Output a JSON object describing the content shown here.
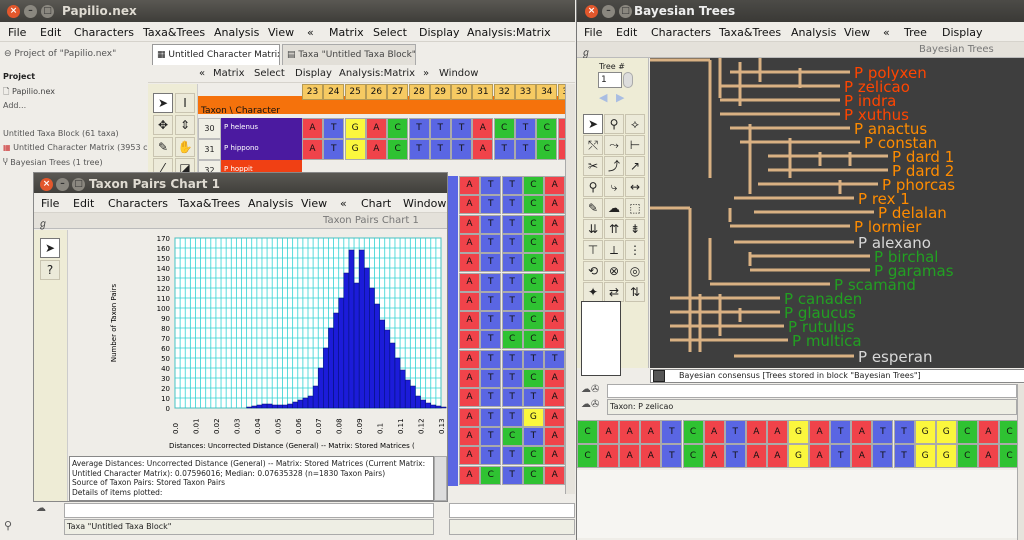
{
  "main": {
    "title": "Papilio.nex",
    "menu": [
      "File",
      "Edit",
      "Characters",
      "Taxa&Trees",
      "Analysis",
      "View",
      "«",
      "Matrix",
      "Select",
      "Display",
      "Analysis:Matrix"
    ],
    "project": {
      "header": "Project of \"Papilio.nex\"",
      "label": "Project",
      "file": "Papilio.nex",
      "add": "Add...",
      "items": [
        "Untitled Taxa Block (61 taxa)",
        "Untitled Character Matrix (3953 cha",
        "Bayesian Trees (1 tree)"
      ]
    },
    "tabs": [
      "Untitled Character Matrix",
      "Taxa \"Untitled Taxa Block\""
    ],
    "matrix_menu": [
      "«",
      "Matrix",
      "Select",
      "Display",
      "Analysis:Matrix",
      "»",
      "Window"
    ],
    "corner": "Taxon \\ Character",
    "col_headers": [
      "23",
      "24",
      "25",
      "26",
      "27",
      "28",
      "29",
      "30",
      "31",
      "32",
      "33",
      "34",
      "35",
      "36"
    ],
    "rows": [
      {
        "num": "30",
        "taxon": "P helenus",
        "bases": [
          "A",
          "T",
          "G",
          "A",
          "C",
          "T",
          "T",
          "T",
          "A",
          "C",
          "T",
          "C",
          "A",
          "A"
        ]
      },
      {
        "num": "31",
        "taxon": "P hippono",
        "bases": [
          "A",
          "T",
          "G",
          "A",
          "C",
          "T",
          "T",
          "T",
          "A",
          "T",
          "T",
          "C",
          "A",
          "A"
        ]
      },
      {
        "num": "32",
        "taxon": "P hoppit"
      }
    ],
    "lower_cols": [
      "A",
      "T",
      "C",
      "T",
      "A"
    ],
    "lower_grid": [
      [
        "A",
        "T",
        "T",
        "C",
        "A"
      ],
      [
        "A",
        "T",
        "T",
        "C",
        "A"
      ],
      [
        "A",
        "T",
        "T",
        "C",
        "A"
      ],
      [
        "A",
        "T",
        "T",
        "C",
        "A"
      ],
      [
        "A",
        "T",
        "T",
        "C",
        "A"
      ],
      [
        "A",
        "T",
        "T",
        "C",
        "A"
      ],
      [
        "A",
        "T",
        "T",
        "C",
        "A"
      ],
      [
        "A",
        "T",
        "T",
        "C",
        "A"
      ],
      [
        "A",
        "T",
        "C",
        "C",
        "A"
      ],
      [
        "A",
        "T",
        "T",
        "T",
        "T"
      ],
      [
        "A",
        "T",
        "T",
        "C",
        "A"
      ],
      [
        "A",
        "T",
        "T",
        "T",
        "A"
      ],
      [
        "A",
        "T",
        "T",
        "G",
        "A"
      ],
      [
        "A",
        "T",
        "C",
        "T",
        "A"
      ],
      [
        "A",
        "T",
        "T",
        "C",
        "A"
      ],
      [
        "A",
        "C",
        "T",
        "C",
        "A"
      ]
    ],
    "status": "Taxa \"Untitled Taxa Block\""
  },
  "chart_win": {
    "title": "Taxon Pairs Chart 1",
    "menu": [
      "File",
      "Edit",
      "Characters",
      "Taxa&Trees",
      "Analysis",
      "View",
      "«",
      "Chart",
      "Window"
    ],
    "subtitle": "Taxon Pairs Chart 1",
    "text": [
      "Average Distances: Uncorrected Distance (General) -- Matrix: Stored Matrices (Current Matrix:",
      "Untitled Character Matrix): 0.07596016; Median: 0.07635328  (n=1830 Taxon Pairs)",
      "Source of  Taxon Pairs: Stored Taxon Pairs",
      "Details of items plotted:"
    ]
  },
  "chart_data": {
    "type": "bar",
    "xlabel": "Distances: Uncorrected Distance (General) -- Matrix: Stored Matrices (",
    "ylabel": "Number of Taxon Pairs",
    "ylim": [
      0,
      170
    ],
    "xlim": [
      0,
      0.13
    ],
    "yticks": [
      "0",
      "10",
      "20",
      "30",
      "40",
      "50",
      "60",
      "70",
      "80",
      "90",
      "100",
      "110",
      "120",
      "130",
      "140",
      "150",
      "160",
      "170"
    ],
    "xticks": [
      "0.0",
      "0.01",
      "0.02",
      "0.03",
      "0.04",
      "0.05",
      "0.06",
      "0.07",
      "0.08",
      "0.09",
      "0.1",
      "0.11",
      "0.12",
      "0.13"
    ],
    "bin_start": 0.0,
    "bin_width": 0.0025,
    "values": [
      0,
      0,
      0,
      0,
      0,
      0,
      0,
      0,
      0,
      0,
      0,
      0,
      0,
      0,
      1,
      2,
      3,
      4,
      4,
      3,
      3,
      3,
      4,
      6,
      8,
      10,
      12,
      22,
      40,
      60,
      80,
      95,
      110,
      135,
      158,
      125,
      158,
      140,
      120,
      104,
      88,
      78,
      65,
      50,
      38,
      28,
      22,
      12,
      8,
      5,
      3,
      2,
      1,
      0
    ],
    "bar_color": "#1c1cd9",
    "grid_color": "#33d3d3"
  },
  "trees": {
    "title": "Bayesian Trees",
    "menu": [
      "File",
      "Edit",
      "Characters",
      "Taxa&Trees",
      "Analysis",
      "View",
      "«",
      "Tree",
      "Display"
    ],
    "subtitle": "Bayesian Trees",
    "tree_label": "Tree #",
    "tree_num": "1",
    "leaves": [
      {
        "name": "P polyxen",
        "color": "#ff4500"
      },
      {
        "name": "P zelicao",
        "color": "#ff4500"
      },
      {
        "name": "P indra",
        "color": "#ff4500"
      },
      {
        "name": "P xuthus",
        "color": "#ff4500"
      },
      {
        "name": "P anactus",
        "color": "#ff8c00"
      },
      {
        "name": "P constan",
        "color": "#ff8c00"
      },
      {
        "name": "P dard 1",
        "color": "#ff8c00"
      },
      {
        "name": "P dard 2",
        "color": "#ff8c00"
      },
      {
        "name": "P phorcas",
        "color": "#ff8c00"
      },
      {
        "name": "P rex 1",
        "color": "#ff8c00"
      },
      {
        "name": "P delalan",
        "color": "#ff8c00"
      },
      {
        "name": "P lormier",
        "color": "#ff8c00"
      },
      {
        "name": "P alexano",
        "color": "#d8d8d8"
      },
      {
        "name": "P birchal",
        "color": "#22a022"
      },
      {
        "name": "P garamas",
        "color": "#22a022"
      },
      {
        "name": "P scamand",
        "color": "#22a022"
      },
      {
        "name": "P canaden",
        "color": "#22a022"
      },
      {
        "name": "P glaucus",
        "color": "#22a022"
      },
      {
        "name": "P rutulus",
        "color": "#22a022"
      },
      {
        "name": "P multica",
        "color": "#22a022"
      },
      {
        "name": "P esperan",
        "color": "#d8d8d8"
      }
    ],
    "status": "Bayesian consensus   [Trees stored in block \"Bayesian Trees\"]",
    "taxon_label": "Taxon: P zelicao",
    "sequence": [
      "C",
      "A",
      "A",
      "A",
      "T",
      "C",
      "A",
      "T",
      "A",
      "A",
      "G",
      "A",
      "T",
      "A",
      "T",
      "T",
      "G",
      "G",
      "C",
      "A",
      "C"
    ],
    "sequence2": [
      "C",
      "A",
      "A",
      "A",
      "T",
      "C",
      "A",
      "T",
      "A",
      "A",
      "G",
      "A",
      "T",
      "A",
      "T",
      "T",
      "G",
      "G",
      "C",
      "A",
      "C"
    ]
  }
}
